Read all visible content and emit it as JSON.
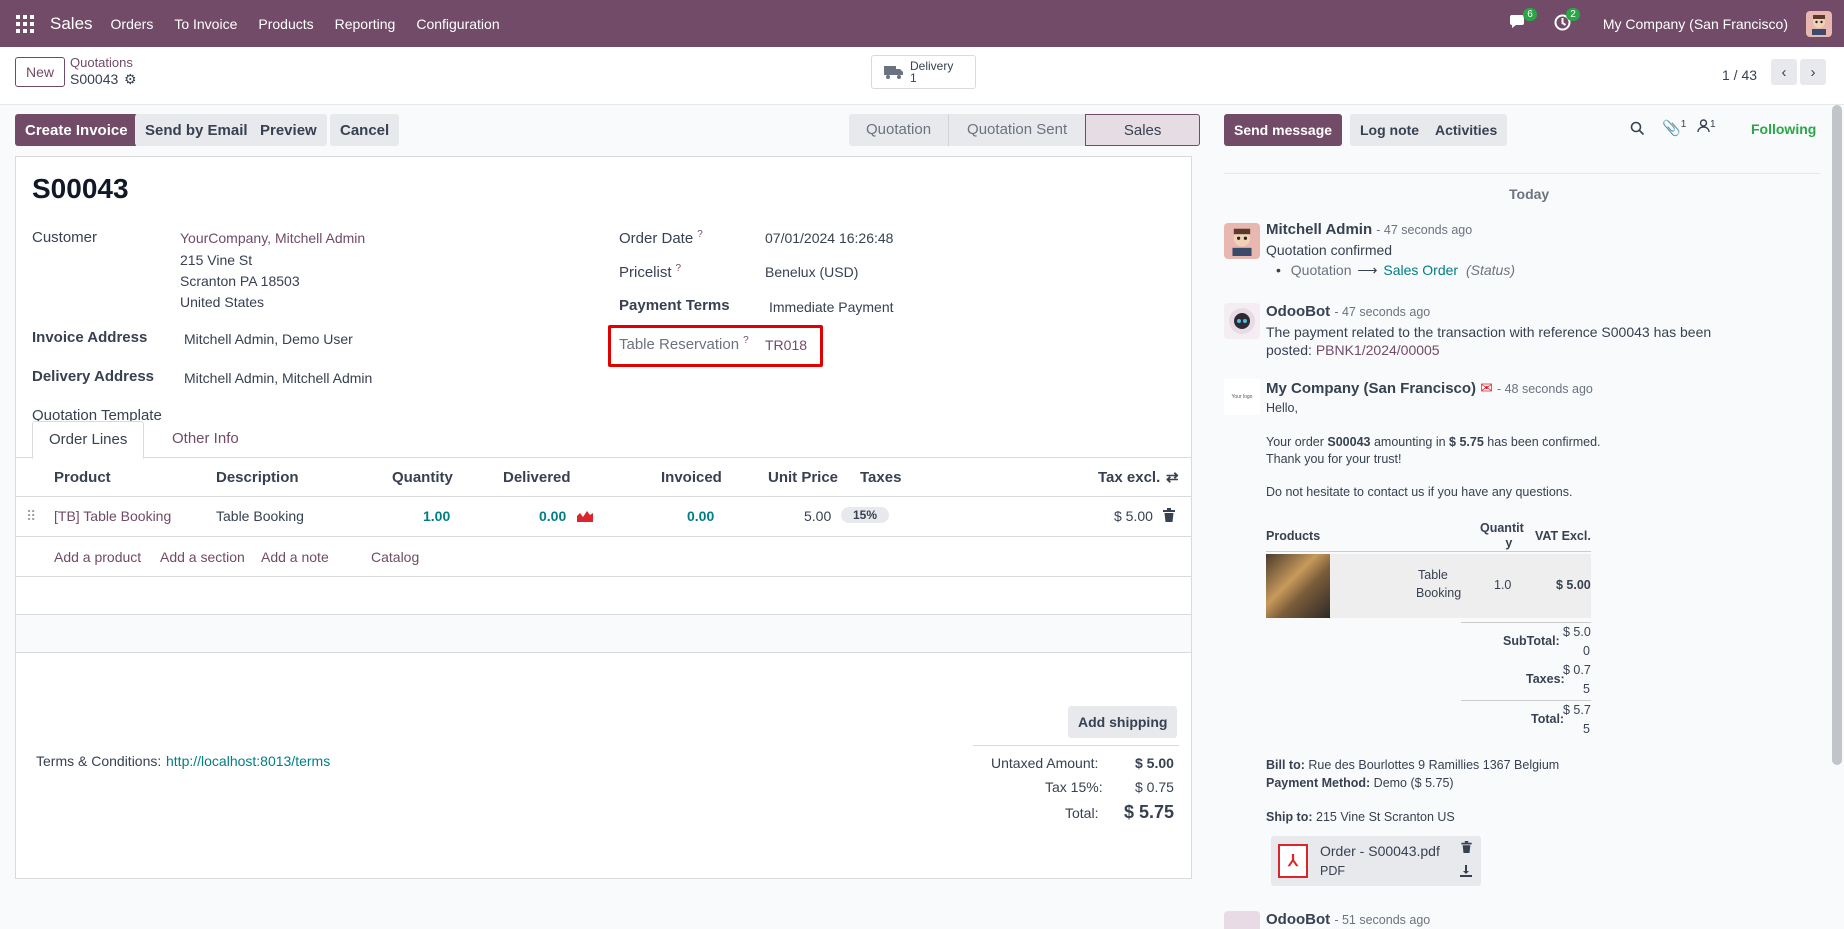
{
  "nav": {
    "app": "Sales",
    "menus": [
      "Orders",
      "To Invoice",
      "Products",
      "Reporting",
      "Configuration"
    ],
    "msg_count": "6",
    "activity_count": "2",
    "company": "My Company (San Francisco)"
  },
  "control": {
    "new_label": "New",
    "breadcrumb_parent": "Quotations",
    "breadcrumb_current": "S00043",
    "delivery_label": "Delivery",
    "delivery_count": "1",
    "pager": "1 / 43"
  },
  "actions": {
    "create_invoice": "Create Invoice",
    "send_email": "Send by Email",
    "preview": "Preview",
    "cancel": "Cancel"
  },
  "status": {
    "stages": [
      "Quotation",
      "Quotation Sent",
      "Sales Order"
    ],
    "active": "Sales Order"
  },
  "form": {
    "name": "S00043",
    "customer_label": "Customer",
    "customer_name": "YourCompany, Mitchell Admin",
    "address1": "215 Vine St",
    "address2": "Scranton PA 18503",
    "address3": "United States",
    "invoice_label": "Invoice Address",
    "invoice_value": "Mitchell Admin, Demo User",
    "delivery_label": "Delivery Address",
    "delivery_value": "Mitchell Admin, Mitchell Admin",
    "template_label": "Quotation Template",
    "order_date_label": "Order Date",
    "order_date": "07/01/2024 16:26:48",
    "pricelist_label": "Pricelist",
    "pricelist": "Benelux (USD)",
    "terms_label": "Payment Terms",
    "terms": "Immediate Payment",
    "table_label": "Table Reservation",
    "table_value": "TR018",
    "help": "?"
  },
  "tabs": {
    "order_lines": "Order Lines",
    "other_info": "Other Info"
  },
  "table": {
    "headers": {
      "product": "Product",
      "description": "Description",
      "quantity": "Quantity",
      "delivered": "Delivered",
      "invoiced": "Invoiced",
      "unit_price": "Unit Price",
      "taxes": "Taxes",
      "tax_excl": "Tax excl."
    },
    "row": {
      "product": "[TB] Table Booking",
      "description": "Table Booking",
      "quantity": "1.00",
      "delivered": "0.00",
      "invoiced": "0.00",
      "unit_price": "5.00",
      "taxes": "15%",
      "subtotal": "$ 5.00"
    },
    "add_product": "Add a product",
    "add_section": "Add a section",
    "add_note": "Add a note",
    "catalog": "Catalog"
  },
  "footer": {
    "add_shipping": "Add shipping",
    "terms_label": "Terms & Conditions:",
    "terms_link": "http://localhost:8013/terms",
    "untaxed_label": "Untaxed Amount:",
    "untaxed": "$ 5.00",
    "tax_label": "Tax 15%:",
    "tax": "$ 0.75",
    "total_label": "Total:",
    "total": "$ 5.75"
  },
  "chatter": {
    "send_message": "Send message",
    "log_note": "Log note",
    "activities": "Activities",
    "attach_count": "1",
    "follower_count": "1",
    "following": "Following",
    "today": "Today",
    "m1": {
      "author": "Mitchell Admin",
      "time": "- 47 seconds ago",
      "text": "Quotation confirmed",
      "from": "Quotation",
      "arrow": "⟶",
      "to": "Sales Order",
      "field": "(Status)"
    },
    "m2": {
      "author": "OdooBot",
      "time": "- 47 seconds ago",
      "text1": "The payment related to the transaction with reference S00043 has been",
      "text2": "posted:",
      "ref": "PBNK1/2024/00005"
    },
    "m3": {
      "author": "My Company (San Francisco)",
      "time": "- 48 seconds ago",
      "hello": "Hello,",
      "l1a": "Your order ",
      "l1b": "S00043",
      "l1c": " amounting in ",
      "l1d": "$ 5.75",
      "l1e": " has been confirmed.",
      "l2": "Thank you for your trust!",
      "l3": "Do not hesitate to contact us if you have any questions.",
      "logo_text": "Your logo",
      "tbl_products": "Products",
      "tbl_qty1": "Quantit",
      "tbl_qty2": "y",
      "tbl_vat": "VAT Excl.",
      "item1": "Table",
      "item2": "Booking",
      "item_qty": "1.0",
      "item_vat": "$ 5.00",
      "subtotal_label": "SubTotal:",
      "subtotal1": "$ 5.0",
      "subtotal2": "0",
      "taxes_label": "Taxes:",
      "taxes1": "$ 0.7",
      "taxes2": "5",
      "total_label": "Total:",
      "total1": "$ 5.7",
      "total2": "5",
      "billto_label": "Bill to:",
      "billto": " Rue des Bourlottes 9 Ramillies 1367 Belgium",
      "paym_label": "Payment Method:",
      "paym": " Demo ($ 5.75)",
      "shipto_label": "Ship to:",
      "shipto": " 215 Vine St Scranton US",
      "att_name": "Order - S00043.pdf",
      "att_type": "PDF"
    },
    "m4": {
      "author": "OdooBot",
      "time": "- 51 seconds ago"
    }
  }
}
